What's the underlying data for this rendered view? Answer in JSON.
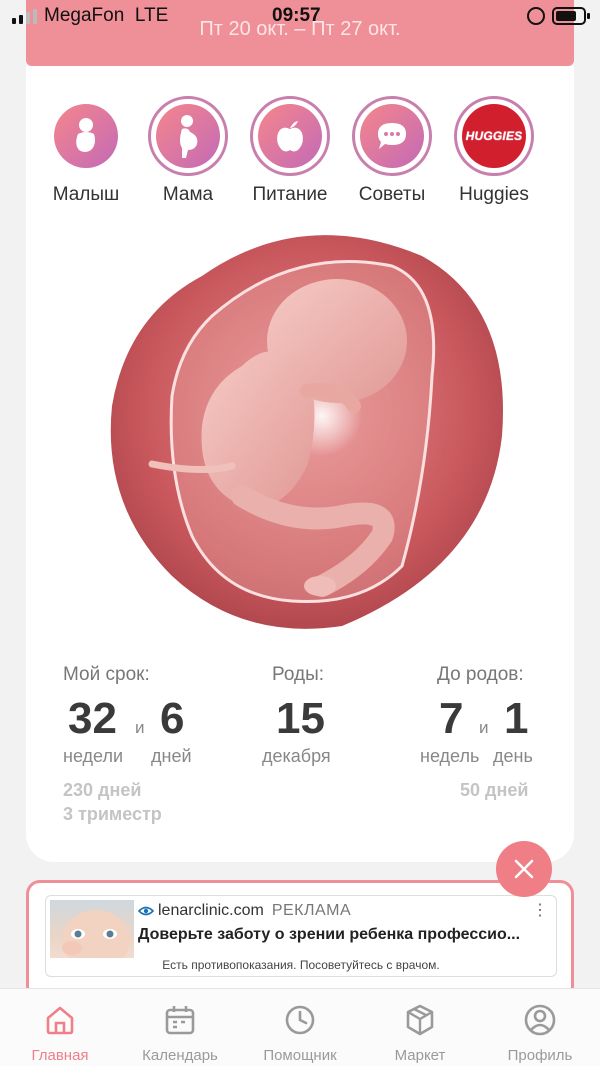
{
  "status_bar": {
    "carrier": "MegaFon",
    "network": "LTE",
    "time": "09:57"
  },
  "week_range": "Пт 20 окт. – Пт 27 окт.",
  "categories": [
    {
      "label": "Малыш",
      "icon": "baby-icon"
    },
    {
      "label": "Мама",
      "icon": "mother-icon"
    },
    {
      "label": "Питание",
      "icon": "apple-icon"
    },
    {
      "label": "Советы",
      "icon": "chat-bubble-icon"
    },
    {
      "label": "Huggies",
      "icon": "huggies-logo",
      "brand_text": "HUGGIES"
    }
  ],
  "term": {
    "label": "Мой срок:",
    "weeks": "32",
    "conj": "и",
    "days": "6",
    "weeks_unit": "недели",
    "days_unit": "дней",
    "total_days": "230 дней",
    "trimester": "3 триместр"
  },
  "birth": {
    "label": "Роды:",
    "day": "15",
    "month": "декабря"
  },
  "until_birth": {
    "label": "До родов:",
    "weeks": "7",
    "conj": "и",
    "days": "1",
    "weeks_unit": "недель",
    "days_unit": "день",
    "total_days": "50 дней"
  },
  "ad": {
    "domain": "lenarclinic.com",
    "tag": "РЕКЛАМА",
    "title": "Доверьте заботу о зрении ребенка профессио...",
    "note": "Есть противопоказания. Посоветуйтесь с врачом."
  },
  "tabs": [
    {
      "label": "Главная",
      "icon": "home-icon",
      "active": true
    },
    {
      "label": "Календарь",
      "icon": "calendar-icon",
      "active": false
    },
    {
      "label": "Помощник",
      "icon": "clock-icon",
      "active": false
    },
    {
      "label": "Маркет",
      "icon": "box-icon",
      "active": false
    },
    {
      "label": "Профиль",
      "icon": "profile-icon",
      "active": false
    }
  ],
  "colors": {
    "accent": "#ef8f97",
    "active_tab": "#ef7f88",
    "huggies": "#d21f2e"
  }
}
